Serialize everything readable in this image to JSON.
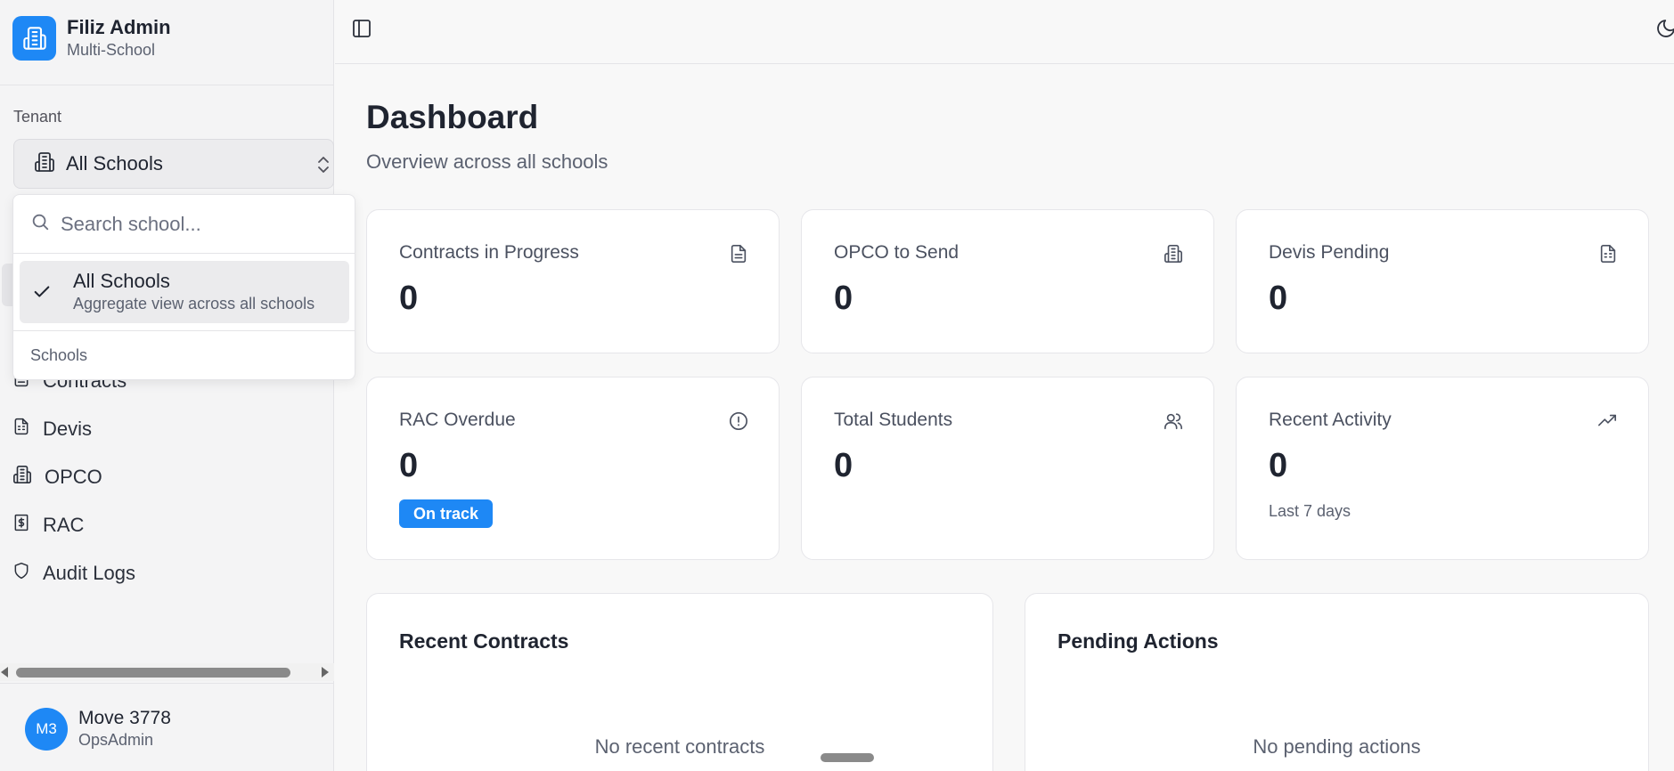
{
  "brand": {
    "title": "Filiz Admin",
    "subtitle": "Multi-School"
  },
  "tenant": {
    "label": "Tenant",
    "selected": "All Schools"
  },
  "dropdown": {
    "search_placeholder": "Search school...",
    "option": {
      "title": "All Schools",
      "subtitle": "Aggregate view across all schools"
    },
    "group_label": "Schools"
  },
  "nav": {
    "items": [
      {
        "label": "Contracts",
        "icon": "file-text-icon"
      },
      {
        "label": "Devis",
        "icon": "file-spreadsheet-icon"
      },
      {
        "label": "OPCO",
        "icon": "building-icon"
      },
      {
        "label": "RAC",
        "icon": "receipt-dollar-icon"
      },
      {
        "label": "Audit Logs",
        "icon": "shield-icon"
      }
    ]
  },
  "user": {
    "initials": "M3",
    "name": "Move 3778",
    "role": "OpsAdmin"
  },
  "page": {
    "title": "Dashboard",
    "subtitle": "Overview across all schools"
  },
  "stats": [
    {
      "label": "Contracts in Progress",
      "value": "0",
      "icon": "file-text-icon"
    },
    {
      "label": "OPCO to Send",
      "value": "0",
      "icon": "building-icon"
    },
    {
      "label": "Devis Pending",
      "value": "0",
      "icon": "file-spreadsheet-icon"
    },
    {
      "label": "RAC Overdue",
      "value": "0",
      "icon": "alert-circle-icon",
      "badge": "On track"
    },
    {
      "label": "Total Students",
      "value": "0",
      "icon": "users-icon"
    },
    {
      "label": "Recent Activity",
      "value": "0",
      "icon": "trending-up-icon",
      "note": "Last 7 days"
    }
  ],
  "panels": {
    "recent_contracts": {
      "title": "Recent Contracts",
      "empty": "No recent contracts"
    },
    "pending_actions": {
      "title": "Pending Actions",
      "empty": "No pending actions"
    }
  },
  "colors": {
    "accent": "#1e88f5",
    "background": "#f8f8f8",
    "sidebar": "#f4f4f5"
  }
}
